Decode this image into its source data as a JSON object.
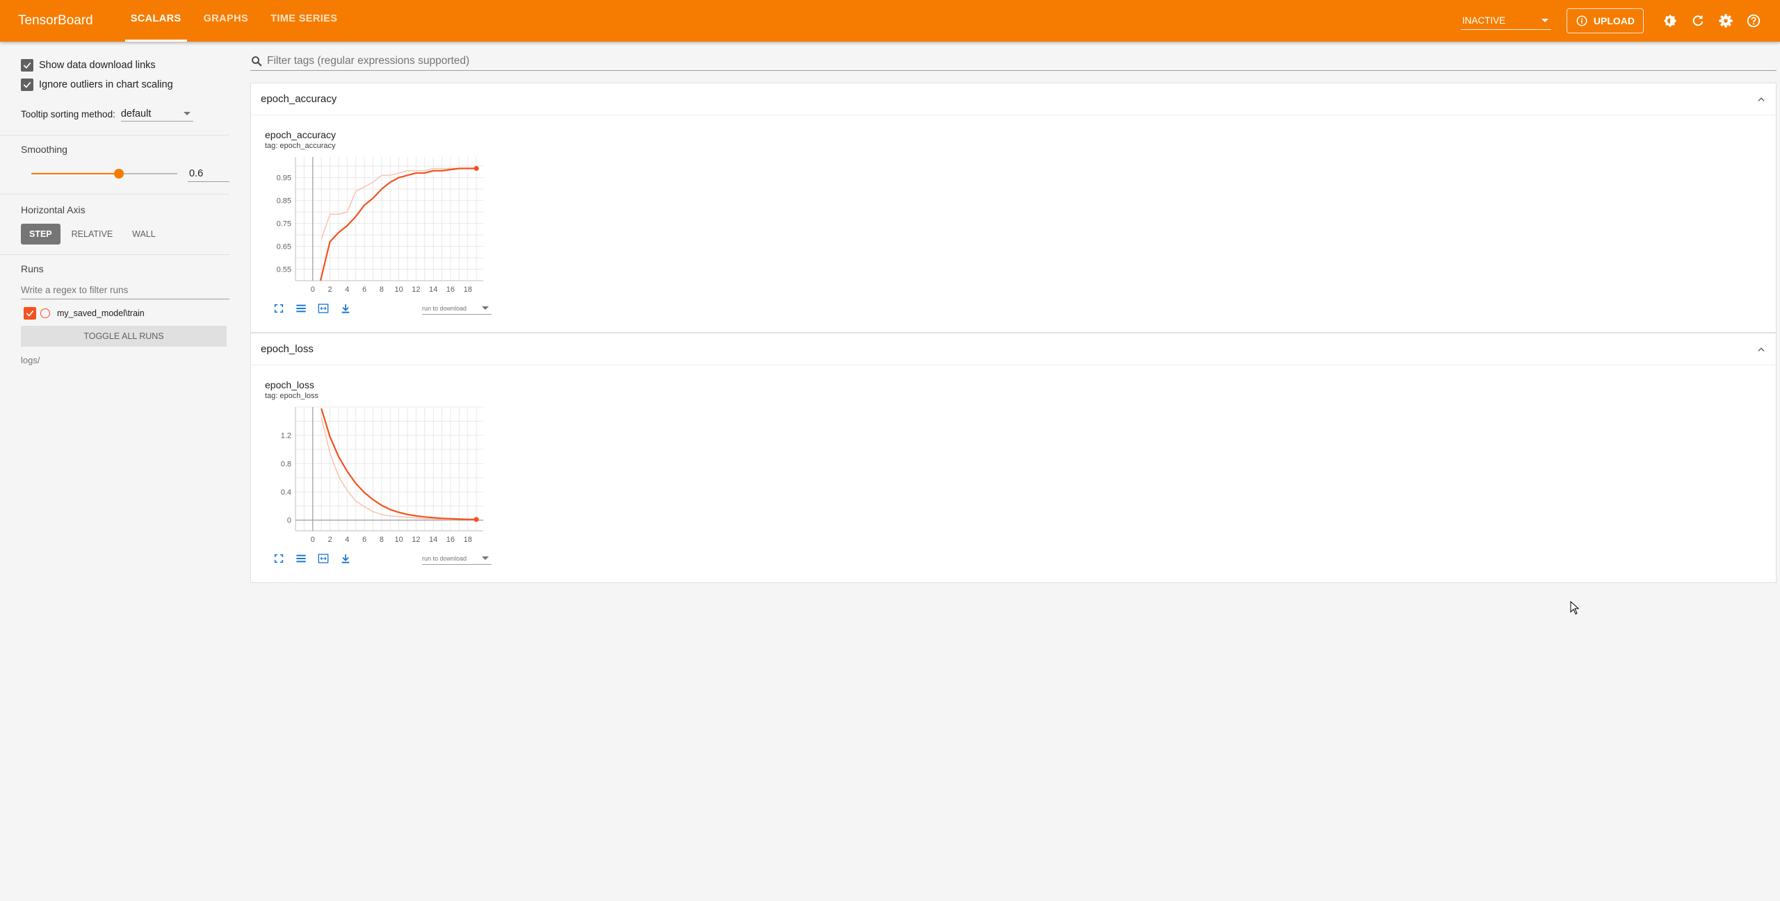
{
  "header": {
    "brand": "TensorBoard",
    "tabs": [
      {
        "label": "SCALARS",
        "active": true
      },
      {
        "label": "GRAPHS",
        "active": false
      },
      {
        "label": "TIME SERIES",
        "active": false
      }
    ],
    "status_select": "INACTIVE",
    "upload_label": "UPLOAD",
    "icons": [
      "brightness-icon",
      "refresh-icon",
      "settings-icon",
      "help-icon"
    ],
    "accent": "#f57c00"
  },
  "sidebar": {
    "show_download_links": "Show data download links",
    "ignore_outliers": "Ignore outliers in chart scaling",
    "tooltip_label": "Tooltip sorting method:",
    "tooltip_value": "default",
    "smoothing_label": "Smoothing",
    "smoothing_value": "0.6",
    "smoothing_fraction": 0.6,
    "horizontal_axis_label": "Horizontal Axis",
    "axis_options": [
      "STEP",
      "RELATIVE",
      "WALL"
    ],
    "axis_selected": "STEP",
    "runs_label": "Runs",
    "runs_filter_placeholder": "Write a regex to filter runs",
    "run_name": "my_saved_model\\train",
    "toggle_all": "TOGGLE ALL RUNS",
    "logdir": "logs/"
  },
  "main": {
    "filter_placeholder": "Filter tags (regular expressions supported)",
    "download_select": "run to download"
  },
  "cards": [
    {
      "header": "epoch_accuracy",
      "title": "epoch_accuracy",
      "tag": "tag: epoch_accuracy"
    },
    {
      "header": "epoch_loss",
      "title": "epoch_loss",
      "tag": "tag: epoch_loss"
    }
  ],
  "chart_data": [
    {
      "type": "line",
      "title": "epoch_accuracy",
      "xlabel": "",
      "ylabel": "",
      "x_ticks": [
        0,
        2,
        4,
        6,
        8,
        10,
        12,
        14,
        16,
        18
      ],
      "y_ticks": [
        0.55,
        0.65,
        0.75,
        0.85,
        0.95
      ],
      "xlim": [
        -2,
        19.8
      ],
      "ylim": [
        0.5,
        1.04
      ],
      "grid": true,
      "series": [
        {
          "role": "raw",
          "color": "#f9c4b0",
          "x": [
            1,
            2,
            3,
            4,
            5,
            6,
            7,
            8,
            9,
            10,
            11,
            12,
            13,
            14,
            15,
            16,
            17,
            18,
            19
          ],
          "y": [
            0.68,
            0.79,
            0.79,
            0.8,
            0.89,
            0.91,
            0.93,
            0.96,
            0.96,
            0.97,
            0.98,
            0.98,
            0.98,
            0.99,
            0.99,
            0.99,
            0.99,
            0.99,
            0.99
          ]
        },
        {
          "role": "smoothed",
          "color": "#f4511e",
          "x": [
            0.9,
            2,
            3,
            4,
            5,
            6,
            7,
            8,
            9,
            10,
            11,
            12,
            13,
            14,
            15,
            16,
            17,
            18,
            19
          ],
          "y": [
            0.5,
            0.67,
            0.71,
            0.74,
            0.78,
            0.83,
            0.86,
            0.9,
            0.93,
            0.95,
            0.96,
            0.97,
            0.97,
            0.98,
            0.98,
            0.985,
            0.99,
            0.99,
            0.99
          ]
        }
      ]
    },
    {
      "type": "line",
      "title": "epoch_loss",
      "xlabel": "",
      "ylabel": "",
      "x_ticks": [
        0,
        2,
        4,
        6,
        8,
        10,
        12,
        14,
        16,
        18
      ],
      "y_ticks": [
        0,
        0.4,
        0.8,
        1.2
      ],
      "xlim": [
        -2,
        19.8
      ],
      "ylim": [
        -0.15,
        1.6
      ],
      "grid": true,
      "series": [
        {
          "role": "raw",
          "color": "#f9c4b0",
          "x": [
            1,
            2,
            3,
            4,
            5,
            6,
            7,
            8,
            9,
            10,
            11,
            12,
            13,
            14,
            15,
            16,
            17,
            18,
            19
          ],
          "y": [
            1.45,
            0.95,
            0.62,
            0.42,
            0.27,
            0.19,
            0.12,
            0.08,
            0.06,
            0.05,
            0.04,
            0.03,
            0.02,
            0.02,
            0.01,
            0.01,
            0.01,
            0.01,
            0.01
          ]
        },
        {
          "role": "smoothed",
          "color": "#f4511e",
          "x": [
            1,
            2,
            3,
            4,
            5,
            6,
            7,
            8,
            9,
            10,
            11,
            12,
            13,
            14,
            15,
            16,
            17,
            18,
            19
          ],
          "y": [
            1.58,
            1.18,
            0.9,
            0.69,
            0.52,
            0.39,
            0.29,
            0.21,
            0.15,
            0.11,
            0.08,
            0.06,
            0.045,
            0.035,
            0.025,
            0.02,
            0.015,
            0.01,
            0.01
          ]
        }
      ]
    }
  ]
}
